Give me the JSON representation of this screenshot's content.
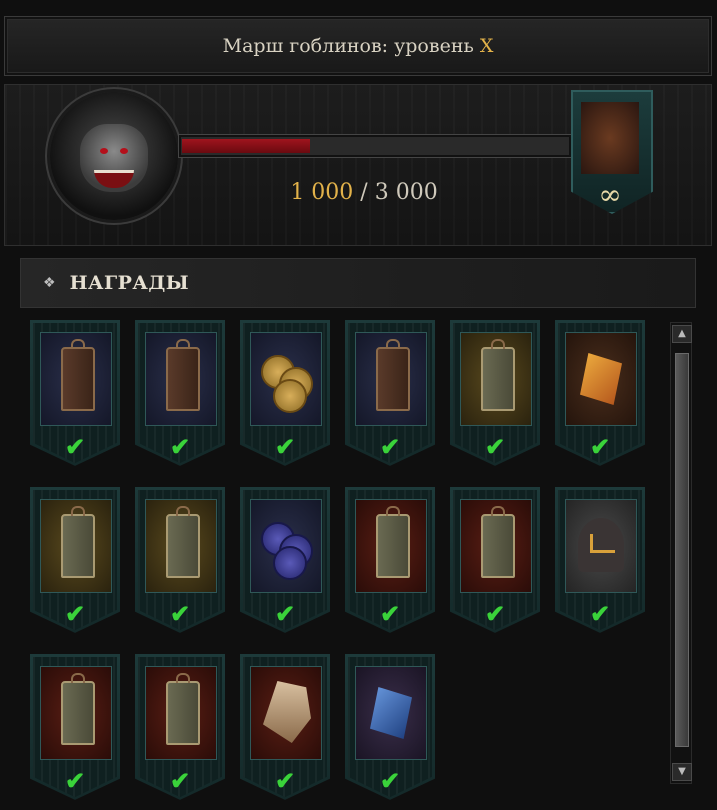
{
  "title": {
    "text": "Марш гоблинов: уровень",
    "level": "X"
  },
  "progress": {
    "current": "1 000",
    "separator": " / ",
    "total": "3 000",
    "fraction": 0.333
  },
  "badge": {
    "icon": "lantern-icon",
    "count": "∞"
  },
  "rewards": {
    "heading": "НАГРАДЫ",
    "check": "✔",
    "items": [
      {
        "icon": "lantern-icon",
        "bg": "navy",
        "claimed": true
      },
      {
        "icon": "lantern-icon",
        "bg": "navy",
        "claimed": true
      },
      {
        "icon": "gold-coins-icon",
        "bg": "navy",
        "claimed": true
      },
      {
        "icon": "lantern-icon",
        "bg": "navy",
        "claimed": true
      },
      {
        "icon": "lantern-icon",
        "bg": "ochre",
        "claimed": true
      },
      {
        "icon": "amber-shard-icon",
        "bg": "brown",
        "claimed": true
      },
      {
        "icon": "lantern-icon",
        "bg": "ochre",
        "claimed": true
      },
      {
        "icon": "lantern-icon",
        "bg": "ochre",
        "claimed": true
      },
      {
        "icon": "blue-coins-icon",
        "bg": "navy",
        "claimed": true
      },
      {
        "icon": "lantern-icon",
        "bg": "red",
        "claimed": true
      },
      {
        "icon": "lantern-icon",
        "bg": "red",
        "claimed": true
      },
      {
        "icon": "rune-helmet-icon",
        "bg": "gray",
        "claimed": true
      },
      {
        "icon": "lantern-icon",
        "bg": "red",
        "claimed": true
      },
      {
        "icon": "lantern-icon",
        "bg": "red",
        "claimed": true
      },
      {
        "icon": "beast-mask-icon",
        "bg": "red",
        "claimed": true
      },
      {
        "icon": "blue-shard-icon",
        "bg": "purple",
        "claimed": true
      }
    ]
  },
  "scrollbar": {
    "up": "▲",
    "down": "▼"
  },
  "colors": {
    "accent": "#e2b24a",
    "progress": "#a0141e",
    "check": "#3ad33a"
  }
}
